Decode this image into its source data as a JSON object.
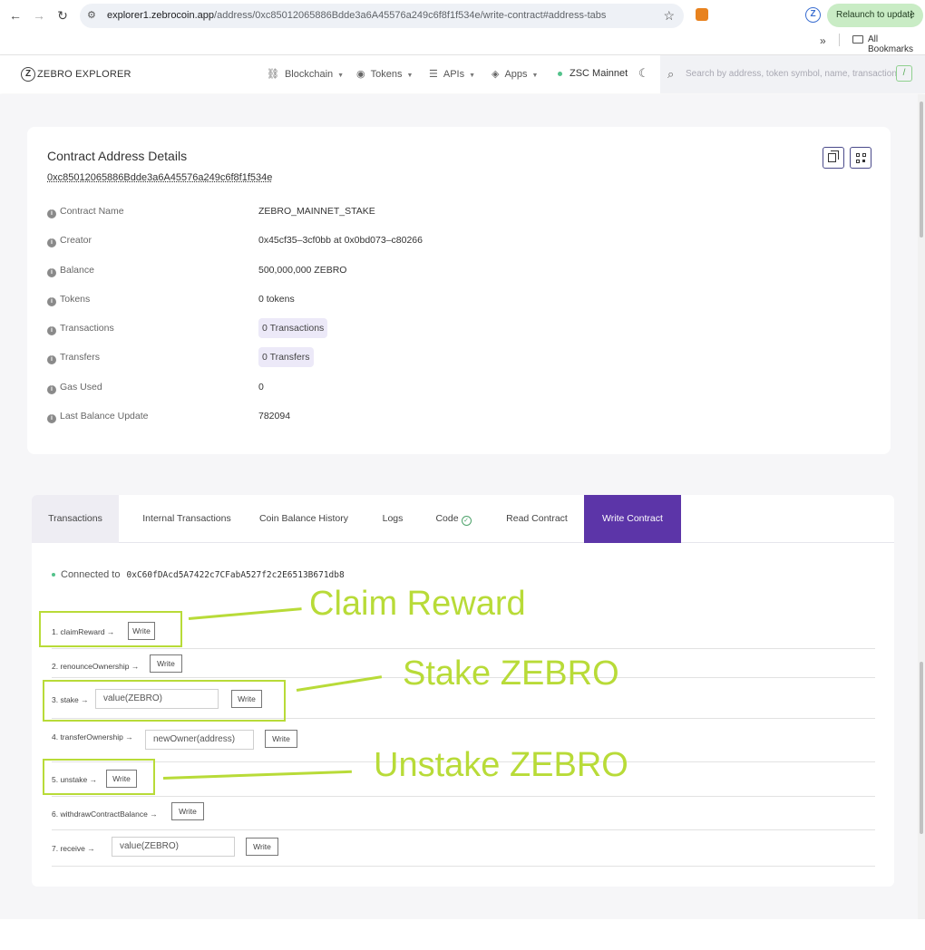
{
  "browser": {
    "url_host": "explorer1.zebrocoin.app",
    "url_path": "/address/0xc85012065886Bdde3a6A45576a249c6f8f1f534e/write-contract#address-tabs",
    "relaunch_label": "Relaunch to update",
    "bookmarks_label": "All Bookmarks"
  },
  "header": {
    "logo_text": "ZEBRO EXPLORER",
    "menu": [
      "Blockchain",
      "Tokens",
      "APIs",
      "Apps"
    ],
    "network": "ZSC Mainnet",
    "search_placeholder": "Search by address, token symbol, name, transaction",
    "search_shortcut": "/"
  },
  "details": {
    "title": "Contract Address Details",
    "address": "0xc85012065886Bdde3a6A45576a249c6f8f1f534e",
    "rows": [
      {
        "label": "Contract Name",
        "value": "ZEBRO_MAINNET_STAKE"
      },
      {
        "label": "Creator",
        "value": "0x45cf35–3cf0bb at 0x0bd073–c80266"
      },
      {
        "label": "Balance",
        "value": "500,000,000 ZEBRO"
      },
      {
        "label": "Tokens",
        "value": "0 tokens"
      },
      {
        "label": "Transactions",
        "value": "0 Transactions"
      },
      {
        "label": "Transfers",
        "value": "0 Transfers"
      },
      {
        "label": "Gas Used",
        "value": "0"
      },
      {
        "label": "Last Balance Update",
        "value": "782094"
      }
    ]
  },
  "tabs": [
    "Transactions",
    "Internal Transactions",
    "Coin Balance History",
    "Logs",
    "Code",
    "Read Contract",
    "Write Contract"
  ],
  "write": {
    "connected_label": "Connected to",
    "connected_address": "0xC60fDAcd5A7422c7CFabA527f2c2E6513B671db8",
    "write_label": "Write",
    "functions": [
      {
        "label": "1. claimReward →"
      },
      {
        "label": "2. renounceOwnership →"
      },
      {
        "label": "3. stake →",
        "input": "value(ZEBRO)"
      },
      {
        "label": "4. transferOwnership →",
        "input": "newOwner(address)"
      },
      {
        "label": "5. unstake →"
      },
      {
        "label": "6. withdrawContractBalance →"
      },
      {
        "label": "7. receive →",
        "input": "value(ZEBRO)"
      }
    ]
  },
  "annotations": {
    "claim": "Claim Reward",
    "stake": "Stake ZEBRO",
    "unstake": "Unstake ZEBRO"
  },
  "colors": {
    "accent": "#5c35a8",
    "annotation": "#b8db38",
    "pill_bg": "#ece9f8"
  }
}
